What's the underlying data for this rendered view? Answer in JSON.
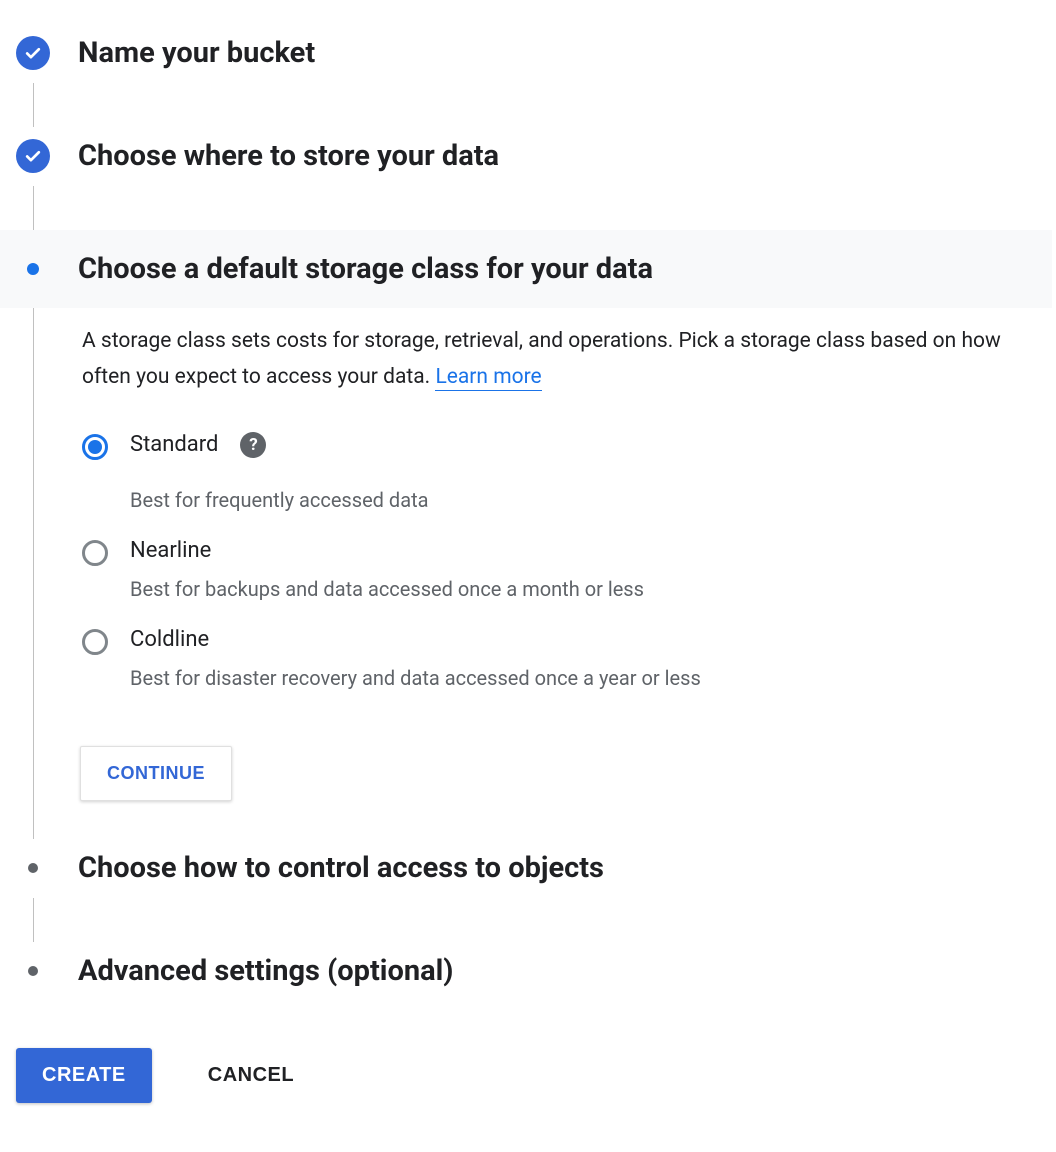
{
  "steps": {
    "name": {
      "title": "Name your bucket"
    },
    "location": {
      "title": "Choose where to store your data"
    },
    "storage_class": {
      "title": "Choose a default storage class for your data",
      "description_prefix": "A storage class sets costs for storage, retrieval, and operations. Pick a storage class based on how often you expect to access your data. ",
      "learn_more": "Learn more",
      "options": [
        {
          "label": "Standard",
          "desc": "Best for frequently accessed data",
          "selected": true,
          "has_help": true
        },
        {
          "label": "Nearline",
          "desc": "Best for backups and data accessed once a month or less",
          "selected": false,
          "has_help": false
        },
        {
          "label": "Coldline",
          "desc": "Best for disaster recovery and data accessed once a year or less",
          "selected": false,
          "has_help": false
        }
      ],
      "continue_label": "CONTINUE"
    },
    "access": {
      "title": "Choose how to control access to objects"
    },
    "advanced": {
      "title": "Advanced settings (optional)"
    }
  },
  "footer": {
    "create_label": "CREATE",
    "cancel_label": "CANCEL"
  }
}
